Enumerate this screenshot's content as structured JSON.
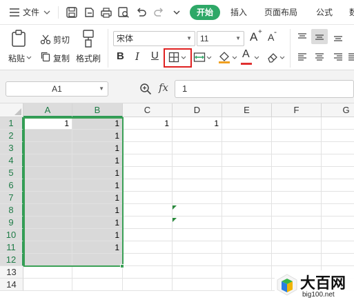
{
  "menubar": {
    "file_label": "文件",
    "start_tab": "开始",
    "tabs": [
      "插入",
      "页面布局",
      "公式",
      "数"
    ]
  },
  "ribbon": {
    "paste_label": "粘贴",
    "cut_label": "剪切",
    "copy_label": "复制",
    "format_painter_label": "格式刷",
    "font_name": "宋体",
    "font_size": "11",
    "bold": "B",
    "italic": "I",
    "underline": "U",
    "grow_font": "A",
    "shrink_font": "A",
    "font_color": "A"
  },
  "formula_bar": {
    "name_box": "A1",
    "fx_label": "fx",
    "value": "1"
  },
  "grid": {
    "columns": [
      "A",
      "B",
      "C",
      "D",
      "E",
      "F",
      "G"
    ],
    "rows": [
      "1",
      "2",
      "3",
      "4",
      "5",
      "6",
      "7",
      "8",
      "9",
      "10",
      "11",
      "12",
      "13",
      "14"
    ],
    "values": {
      "A1": "1",
      "B1": "1",
      "C1": "1",
      "D1": "1",
      "B2": "1",
      "B3": "1",
      "B4": "1",
      "B5": "1",
      "B6": "1",
      "B7": "1",
      "B8": "1",
      "B9": "1",
      "B10": "1",
      "B11": "1"
    }
  },
  "watermark": {
    "brand": "大百网",
    "site": "big100.net"
  },
  "colors": {
    "accent": "#2ea867",
    "selection": "#3aa055",
    "highlight_box": "#e02020"
  }
}
